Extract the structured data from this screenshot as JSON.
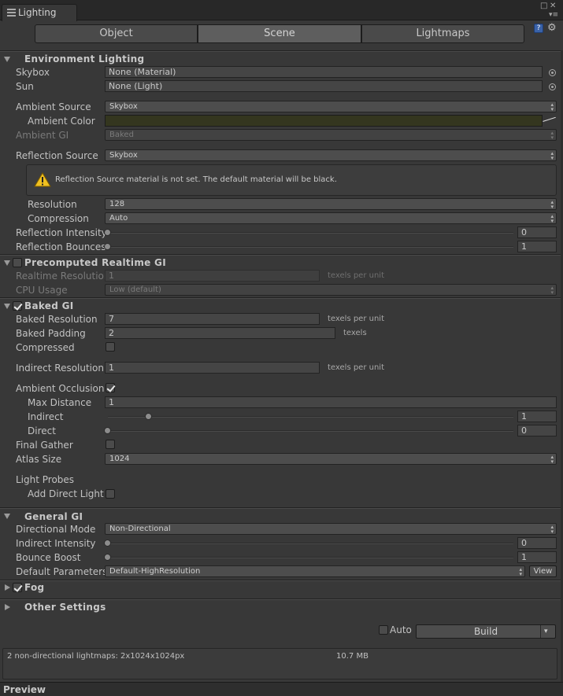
{
  "window": {
    "tab_title": "Lighting",
    "toolbar_tabs": [
      "Object",
      "Scene",
      "Lightmaps"
    ],
    "active_tab": "Scene",
    "icons": {
      "tab": "list-icon",
      "help": "help-book-icon",
      "settings": "gear-icon"
    }
  },
  "environment": {
    "title": "Environment Lighting",
    "skybox_label": "Skybox",
    "skybox_value": "None (Material)",
    "sun_label": "Sun",
    "sun_value": "None (Light)",
    "ambient_source_label": "Ambient Source",
    "ambient_source_value": "Skybox",
    "ambient_color_label": "Ambient Color",
    "ambient_color": "#34361f",
    "ambient_gi_label": "Ambient GI",
    "ambient_gi_value": "Baked",
    "reflection_source_label": "Reflection Source",
    "reflection_source_value": "Skybox",
    "warning_text": "Reflection Source material is not set. The default material will be black.",
    "resolution_label": "Resolution",
    "resolution_value": "128",
    "compression_label": "Compression",
    "compression_value": "Auto",
    "reflection_intensity_label": "Reflection Intensity",
    "reflection_intensity_value": "0",
    "reflection_bounces_label": "Reflection Bounces",
    "reflection_bounces_value": "1"
  },
  "precomputed": {
    "title": "Precomputed Realtime GI",
    "enabled": false,
    "realtime_resolution_label": "Realtime Resolution",
    "realtime_resolution_value": "1",
    "realtime_resolution_unit": "texels per unit",
    "cpu_usage_label": "CPU Usage",
    "cpu_usage_value": "Low (default)"
  },
  "baked": {
    "title": "Baked GI",
    "enabled": true,
    "baked_resolution_label": "Baked Resolution",
    "baked_resolution_value": "7",
    "baked_resolution_unit": "texels per unit",
    "baked_padding_label": "Baked Padding",
    "baked_padding_value": "2",
    "baked_padding_unit": "texels",
    "compressed_label": "Compressed",
    "compressed": false,
    "indirect_resolution_label": "Indirect Resolution",
    "indirect_resolution_value": "1",
    "indirect_resolution_unit": "texels per unit",
    "ambient_occlusion_label": "Ambient Occlusion",
    "ambient_occlusion": true,
    "max_distance_label": "Max Distance",
    "max_distance_value": "1",
    "indirect_label": "Indirect",
    "indirect_value": "1",
    "indirect_fraction": 0.1,
    "direct_label": "Direct",
    "direct_value": "0",
    "direct_fraction": 0,
    "final_gather_label": "Final Gather",
    "final_gather": false,
    "atlas_size_label": "Atlas Size",
    "atlas_size_value": "1024",
    "light_probes_label": "Light Probes",
    "add_direct_light_label": "Add Direct Light",
    "add_direct_light": false
  },
  "general": {
    "title": "General GI",
    "directional_mode_label": "Directional Mode",
    "directional_mode_value": "Non-Directional",
    "indirect_intensity_label": "Indirect Intensity",
    "indirect_intensity_value": "0",
    "bounce_boost_label": "Bounce Boost",
    "bounce_boost_value": "1",
    "default_parameters_label": "Default Parameters",
    "default_parameters_value": "Default-HighResolution",
    "view_label": "View"
  },
  "fog": {
    "title": "Fog",
    "enabled": true
  },
  "other": {
    "title": "Other Settings"
  },
  "build": {
    "auto_label": "Auto",
    "auto": false,
    "build_label": "Build"
  },
  "info": {
    "lightmaps_text": "2 non-directional lightmaps: 2x1024x1024px",
    "size_text": "10.7 MB"
  },
  "preview": {
    "title": "Preview"
  }
}
